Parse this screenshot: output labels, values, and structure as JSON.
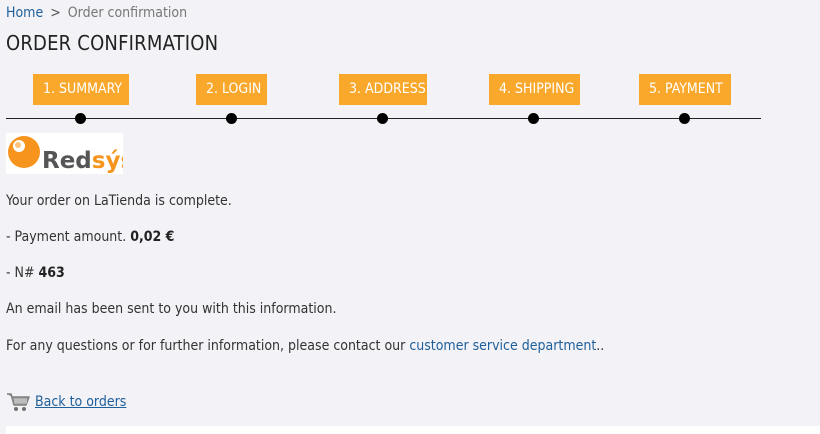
{
  "breadcrumb": {
    "home": "Home",
    "separator": ">",
    "current": "Order confirmation"
  },
  "page_title": "ORDER CONFIRMATION",
  "steps": [
    {
      "label": "1. SUMMARY"
    },
    {
      "label": "2. LOGIN"
    },
    {
      "label": "3. ADDRESS"
    },
    {
      "label": "4. SHIPPING"
    },
    {
      "label": "5. PAYMENT"
    }
  ],
  "colors": {
    "step_accent": "#f9a82c",
    "link": "#1f5f9a",
    "logo_orange": "#f7941d",
    "logo_text": "#555555"
  },
  "logo": {
    "text_dark": "Red",
    "text_accent": "sýs"
  },
  "confirmation": {
    "complete_text": "Your order on LaTienda is complete.",
    "amount_label": "- Payment amount.",
    "amount_value": "0,02 €",
    "number_label": "- N#",
    "number_value": "463",
    "email_text": "An email has been sent to you with this information.",
    "contact_text": "For any questions or for further information, please contact our",
    "contact_link": "customer service department",
    "contact_suffix": ".."
  },
  "back": {
    "icon": "cart-icon",
    "label": "Back to orders"
  }
}
